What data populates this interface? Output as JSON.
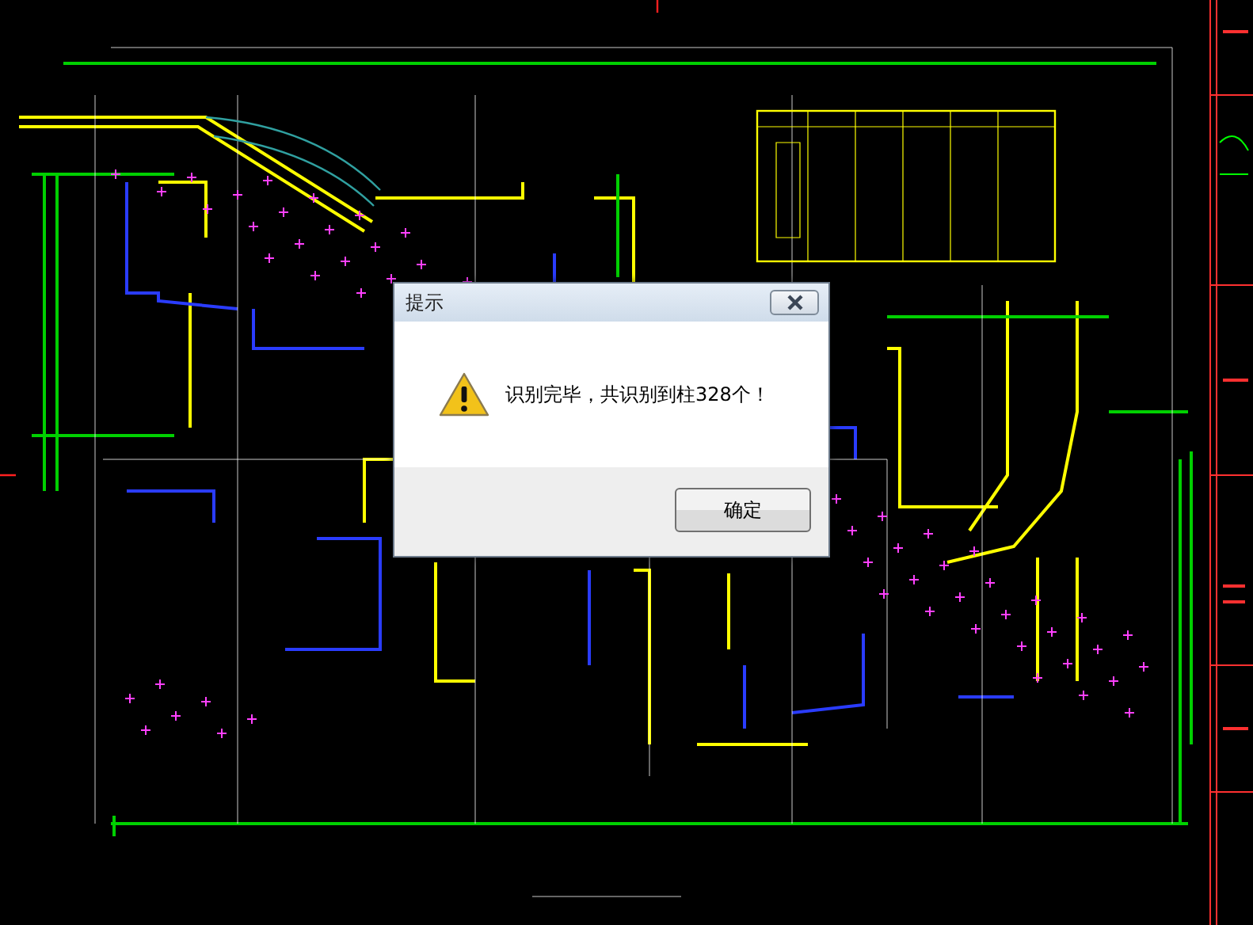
{
  "dialog": {
    "title": "提示",
    "message": "识别完毕，共识别到柱328个！",
    "buttons": [
      "确定"
    ]
  }
}
